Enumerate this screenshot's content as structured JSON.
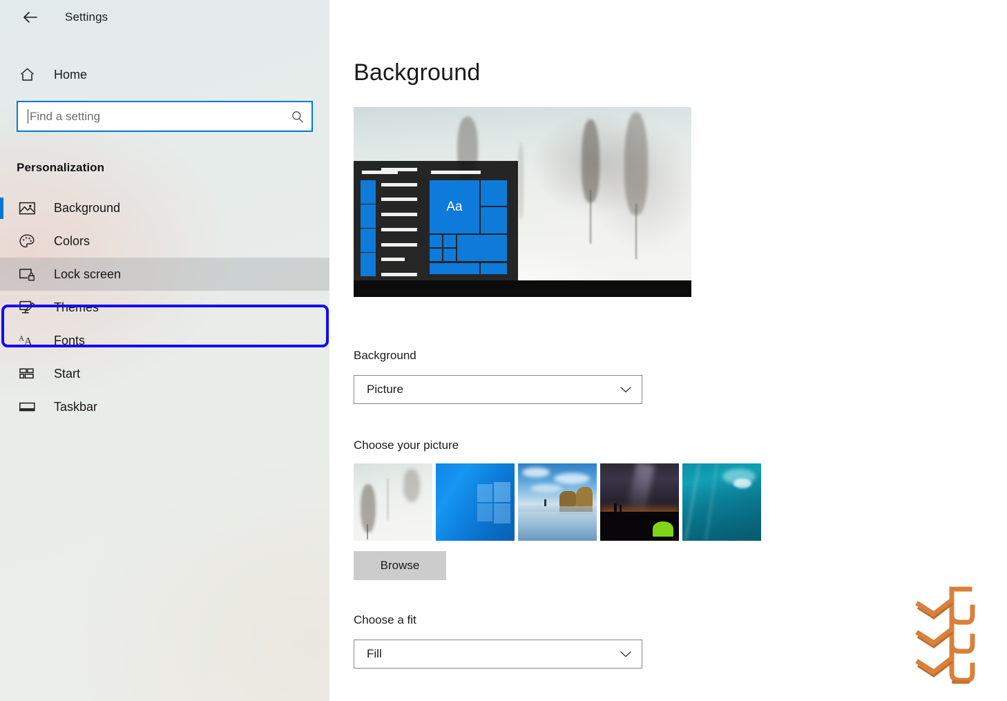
{
  "window": {
    "title": "Settings",
    "back_icon": "back-arrow-icon"
  },
  "sidebar": {
    "home": {
      "label": "Home",
      "icon": "home-icon"
    },
    "search": {
      "value": "",
      "placeholder": "Find a setting",
      "icon": "search-icon"
    },
    "section_header": "Personalization",
    "items": [
      {
        "label": "Background",
        "icon": "picture-icon",
        "selected": true,
        "highlighted": false,
        "annotated": false
      },
      {
        "label": "Colors",
        "icon": "palette-icon",
        "selected": false,
        "highlighted": false,
        "annotated": false
      },
      {
        "label": "Lock screen",
        "icon": "lock-screen-icon",
        "selected": false,
        "highlighted": true,
        "annotated": true
      },
      {
        "label": "Themes",
        "icon": "themes-brush-icon",
        "selected": false,
        "highlighted": false,
        "annotated": false
      },
      {
        "label": "Fonts",
        "icon": "fonts-aa-icon",
        "selected": false,
        "highlighted": false,
        "annotated": false
      },
      {
        "label": "Start",
        "icon": "start-tiles-icon",
        "selected": false,
        "highlighted": false,
        "annotated": false
      },
      {
        "label": "Taskbar",
        "icon": "taskbar-icon",
        "selected": false,
        "highlighted": false,
        "annotated": false
      }
    ]
  },
  "main": {
    "page_title": "Background",
    "preview": {
      "name": "desktop-preview",
      "start_tile_text": "Aa"
    },
    "background": {
      "label": "Background",
      "value": "Picture"
    },
    "choose_picture": {
      "label": "Choose your picture",
      "thumbnails": [
        {
          "name": "thumbnail-misty-trees"
        },
        {
          "name": "thumbnail-windows-logo"
        },
        {
          "name": "thumbnail-beach-sea-stacks"
        },
        {
          "name": "thumbnail-night-sky-tent"
        },
        {
          "name": "thumbnail-underwater"
        }
      ],
      "browse_label": "Browse"
    },
    "choose_fit": {
      "label": "Choose a fit",
      "value": "Fill"
    }
  },
  "colors": {
    "accent_blue": "#0078d4",
    "annotation_blue": "#1408f5",
    "tile_blue": "#0e7ada",
    "logo_orange": "#d9803a"
  },
  "watermark": {
    "name": "brand-logo-watermark"
  }
}
